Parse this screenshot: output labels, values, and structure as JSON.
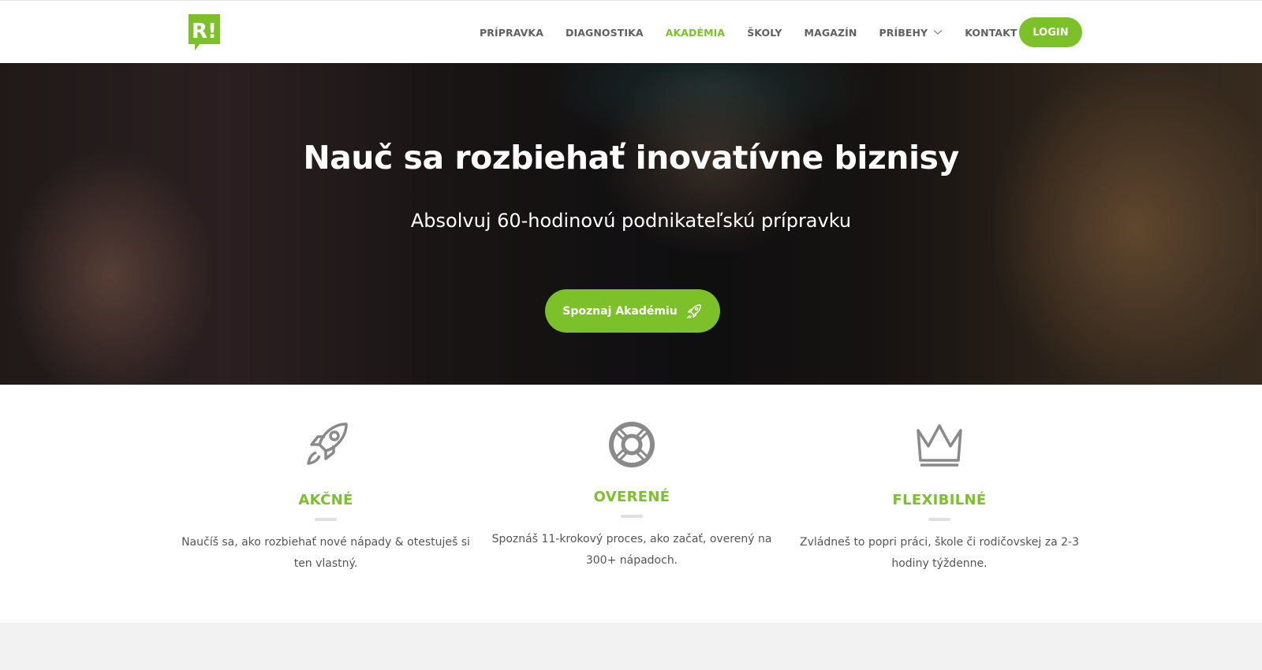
{
  "brand": {
    "logo_text": "R!",
    "accent_color": "#7cc02a"
  },
  "nav": {
    "items": [
      {
        "label": "PRÍPRAVKA",
        "active": false
      },
      {
        "label": "DIAGNOSTIKA",
        "active": false
      },
      {
        "label": "AKADÉMIA",
        "active": true
      },
      {
        "label": "ŠKOLY",
        "active": false
      },
      {
        "label": "MAGAZÍN",
        "active": false
      },
      {
        "label": "PRÍBEHY",
        "active": false,
        "has_dropdown": true
      },
      {
        "label": "KONTAKT",
        "active": false
      }
    ],
    "login_label": "LOGIN"
  },
  "hero": {
    "title": "Nauč sa rozbiehať inovatívne biznisy",
    "subtitle": "Absolvuj 60-hodinovú podnikateľskú prípravku",
    "cta_label": "Spoznaj Akadémiu",
    "cta_icon": "rocket-icon"
  },
  "features": [
    {
      "icon": "rocket-icon",
      "title": "AKČNÉ",
      "text": "Naučíš sa, ako rozbiehať nové nápady & otestuješ si ten vlastný."
    },
    {
      "icon": "lifebuoy-icon",
      "title": "OVERENÉ",
      "text": "Spoznáš 11-krokový proces, ako začať, overený na 300+ nápadoch."
    },
    {
      "icon": "crown-icon",
      "title": "FLEXIBILNÉ",
      "text": "Zvládneš to popri práci, škole či rodičovskej za 2-3 hodiny týždenne."
    }
  ]
}
